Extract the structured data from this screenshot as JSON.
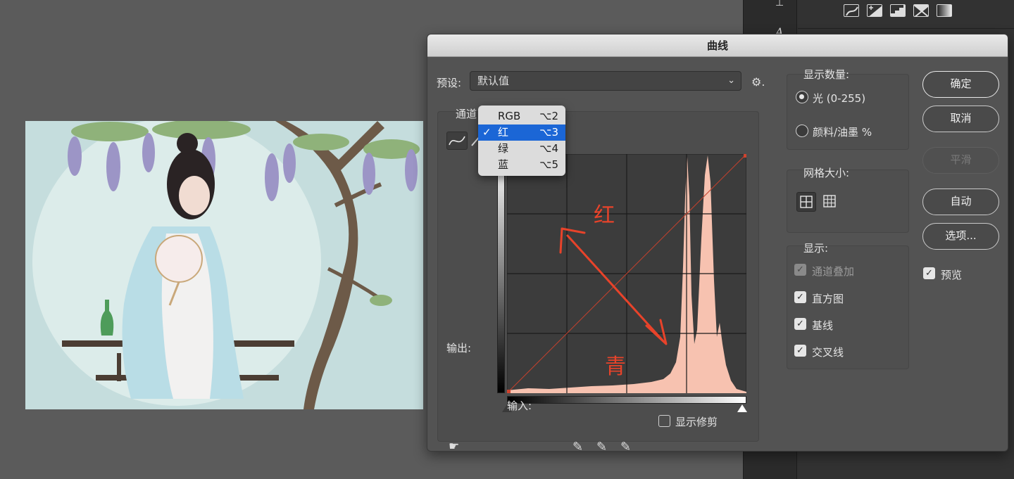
{
  "dialog": {
    "title": "曲线",
    "preset_label": "预设:",
    "preset_value": "默认值",
    "channel_label": "通道",
    "channel_menu": [
      {
        "label": "RGB",
        "shortcut": "⌥2",
        "selected": false
      },
      {
        "label": "红",
        "shortcut": "⌥3",
        "selected": true
      },
      {
        "label": "绿",
        "shortcut": "⌥4",
        "selected": false
      },
      {
        "label": "蓝",
        "shortcut": "⌥5",
        "selected": false
      }
    ],
    "output_label": "输出:",
    "input_label": "输入:",
    "show_clipping_label": "显示修剪",
    "annotation_red": "红",
    "annotation_cyan": "青"
  },
  "display_amount": {
    "title": "显示数量:",
    "option_light": "光 (0-255)",
    "option_pigment": "颜料/油墨 %",
    "selected": "light"
  },
  "grid_size": {
    "title": "网格大小:"
  },
  "show": {
    "title": "显示:",
    "channel_overlay": "通道叠加",
    "histogram": "直方图",
    "baseline": "基线",
    "intersection": "交叉线"
  },
  "buttons": {
    "ok": "确定",
    "cancel": "取消",
    "smooth": "平滑",
    "auto": "自动",
    "options": "选项...",
    "preview": "预览"
  },
  "colors": {
    "histogram_fill": "#f7c2b0",
    "annotation": "#e8432a",
    "selection_blue": "#1b66d6"
  }
}
